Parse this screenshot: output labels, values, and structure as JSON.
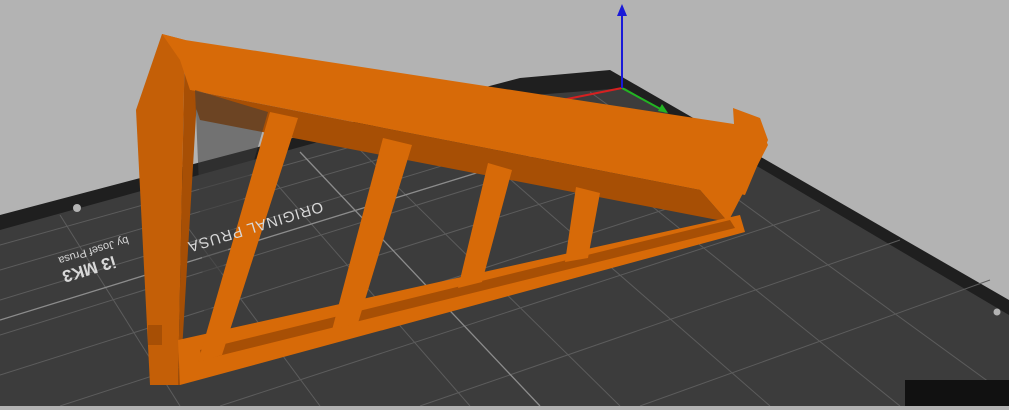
{
  "bed": {
    "brand_text": "ORIGINAL PRUSA",
    "model_text": "i3 MK3",
    "author_text": "by Josef Prusa"
  },
  "colors": {
    "background": "#b3b3b3",
    "bed_surface": "#3a3a3a",
    "bed_frame": "#1d1d1d",
    "grid_minor": "#5a5a5a",
    "grid_major": "#8a8a8a",
    "model": "#d76a08",
    "model_shadow": "#a74f05",
    "axis_x": "#d62020",
    "axis_y": "#22b422",
    "axis_z": "#1a1ad8"
  },
  "axes": [
    "x-axis",
    "y-axis",
    "z-axis"
  ]
}
